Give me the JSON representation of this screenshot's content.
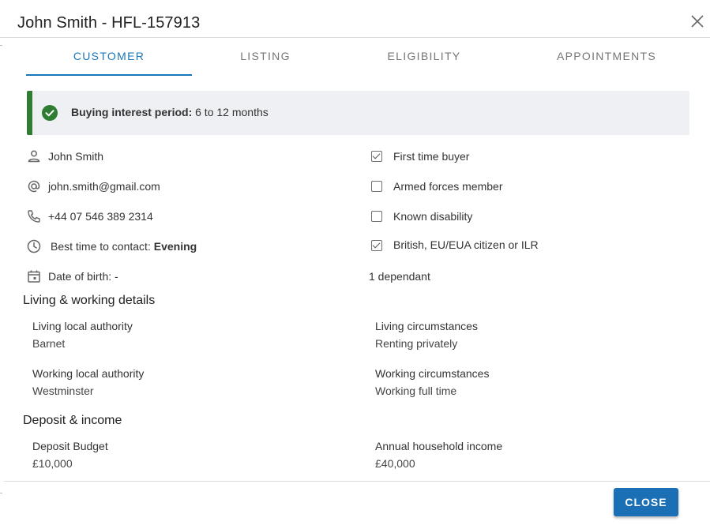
{
  "dialog": {
    "title": "John Smith - HFL-157913",
    "close_icon": "close-icon"
  },
  "tabs": [
    {
      "label": "CUSTOMER",
      "active": true
    },
    {
      "label": "LISTING",
      "active": false
    },
    {
      "label": "ELIGIBILITY",
      "active": false
    },
    {
      "label": "APPOINTMENTS",
      "active": false
    }
  ],
  "banner": {
    "icon": "check-circle-icon",
    "label": "Buying interest period:",
    "value": "6 to 12 months",
    "accent_color": "#2e7d32"
  },
  "contact": {
    "name": {
      "icon": "person-icon",
      "text": "John Smith"
    },
    "email": {
      "icon": "at-icon",
      "text": "john.smith@gmail.com"
    },
    "phone": {
      "icon": "phone-icon",
      "text": "+44 07 546 389 2314"
    },
    "best_time": {
      "icon": "clock-icon",
      "label": "Best time to contact:",
      "value": "Evening"
    },
    "dob": {
      "icon": "calendar-icon",
      "text": "Date of birth: -"
    }
  },
  "flags": [
    {
      "label": "First time buyer",
      "checked": true
    },
    {
      "label": "Armed forces member",
      "checked": false
    },
    {
      "label": "Known disability",
      "checked": false
    },
    {
      "label": "British, EU/EUA citizen or ILR",
      "checked": true
    }
  ],
  "dependants": "1 dependant",
  "living_working": {
    "title": "Living & working details",
    "fields": [
      {
        "label": "Living local authority",
        "value": "Barnet"
      },
      {
        "label": "Living circumstances",
        "value": "Renting privately"
      },
      {
        "label": "Working local authority",
        "value": "Westminster"
      },
      {
        "label": "Working circumstances",
        "value": "Working full time"
      }
    ]
  },
  "deposit_income": {
    "title": "Deposit & income",
    "fields": [
      {
        "label": "Deposit Budget",
        "value": "£10,000"
      },
      {
        "label": "Annual household income",
        "value": "£40,000"
      }
    ]
  },
  "footer": {
    "close_label": "CLOSE",
    "button_color": "#1b6fb5"
  },
  "colors": {
    "primary": "#1976b8",
    "success": "#2e7d32",
    "banner_bg": "#eef0f3"
  }
}
